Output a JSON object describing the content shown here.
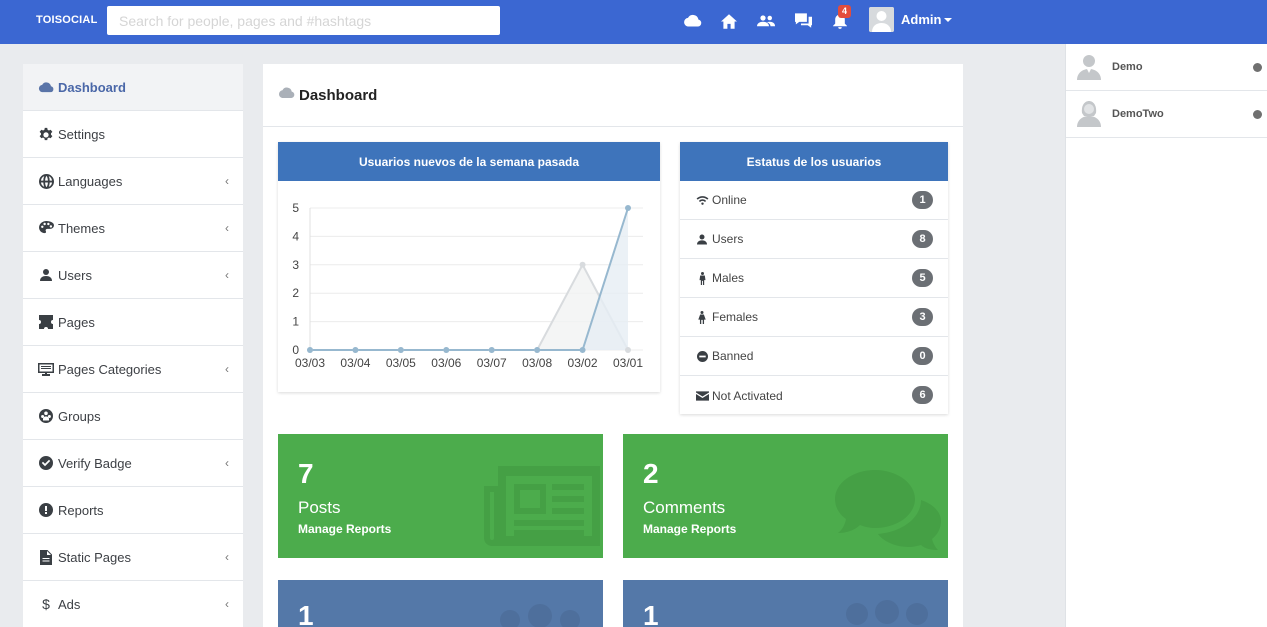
{
  "app": {
    "brand": "TOISOCIAL"
  },
  "search": {
    "placeholder": "Search for people, pages and #hashtags"
  },
  "topnav": {
    "icons": [
      "cloud-icon",
      "home-icon",
      "users-icon",
      "chat-icon",
      "bell-icon"
    ],
    "notifications_count": "4",
    "user_name": "Admin"
  },
  "sidebar": {
    "items": [
      {
        "label": "Dashboard",
        "icon": "cloud-icon",
        "active": true,
        "submenu": false
      },
      {
        "label": "Settings",
        "icon": "gear-icon",
        "submenu": false
      },
      {
        "label": "Languages",
        "icon": "globe-icon",
        "submenu": true
      },
      {
        "label": "Themes",
        "icon": "palette-icon",
        "submenu": true
      },
      {
        "label": "Users",
        "icon": "user-icon",
        "submenu": true
      },
      {
        "label": "Pages",
        "icon": "puzzle-icon",
        "submenu": false
      },
      {
        "label": "Pages Categories",
        "icon": "categories-icon",
        "submenu": true
      },
      {
        "label": "Groups",
        "icon": "groups-icon",
        "submenu": false
      },
      {
        "label": "Verify Badge",
        "icon": "check-circle-icon",
        "submenu": true
      },
      {
        "label": "Reports",
        "icon": "alert-icon",
        "submenu": false
      },
      {
        "label": "Static Pages",
        "icon": "file-icon",
        "submenu": true
      },
      {
        "label": "Ads",
        "icon": "dollar-icon",
        "submenu": true
      }
    ],
    "chevron": "‹"
  },
  "main": {
    "title": "Dashboard"
  },
  "chart_panel": {
    "title": "Usuarios nuevos de la semana pasada"
  },
  "chart_data": {
    "type": "line",
    "title": "Usuarios nuevos de la semana pasada",
    "categories": [
      "03/03",
      "03/04",
      "03/05",
      "03/06",
      "03/07",
      "03/08",
      "03/02",
      "03/01"
    ],
    "series": [
      {
        "values": [
          0,
          0,
          0,
          0,
          0,
          0,
          3,
          0
        ],
        "color": "#d8dbde",
        "fill": "#f1f2f3"
      },
      {
        "values": [
          0,
          0,
          0,
          0,
          0,
          0,
          0,
          5
        ],
        "color": "#97b8cf",
        "fill": "#e6eef4"
      }
    ],
    "ylim": [
      0,
      5
    ],
    "yticks": [
      0,
      1,
      2,
      3,
      4,
      5
    ],
    "grid": true
  },
  "status_panel": {
    "title": "Estatus de los usuarios",
    "rows": [
      {
        "label": "Online",
        "icon": "wifi-icon",
        "count": "1"
      },
      {
        "label": "Users",
        "icon": "user-icon",
        "count": "8"
      },
      {
        "label": "Males",
        "icon": "male-icon",
        "count": "5"
      },
      {
        "label": "Females",
        "icon": "female-icon",
        "count": "3"
      },
      {
        "label": "Banned",
        "icon": "minus-circle-icon",
        "count": "0"
      },
      {
        "label": "Not Activated",
        "icon": "envelope-icon",
        "count": "6"
      }
    ]
  },
  "tiles": [
    {
      "number": "7",
      "label": "Posts",
      "sub": "Manage Reports",
      "color": "#4cac4c",
      "icon": "newspaper-icon"
    },
    {
      "number": "2",
      "label": "Comments",
      "sub": "Manage Reports",
      "color": "#4cac4c",
      "icon": "comments-icon"
    },
    {
      "number": "1",
      "label": "",
      "sub": "",
      "color": "#5478a8",
      "icon": "groups-icon"
    },
    {
      "number": "1",
      "label": "",
      "sub": "",
      "color": "#5478a8",
      "icon": "groups-icon"
    }
  ],
  "online_users": [
    {
      "name": "Demo",
      "avatar": "male-avatar-icon"
    },
    {
      "name": "DemoTwo",
      "avatar": "female-avatar-icon"
    }
  ]
}
